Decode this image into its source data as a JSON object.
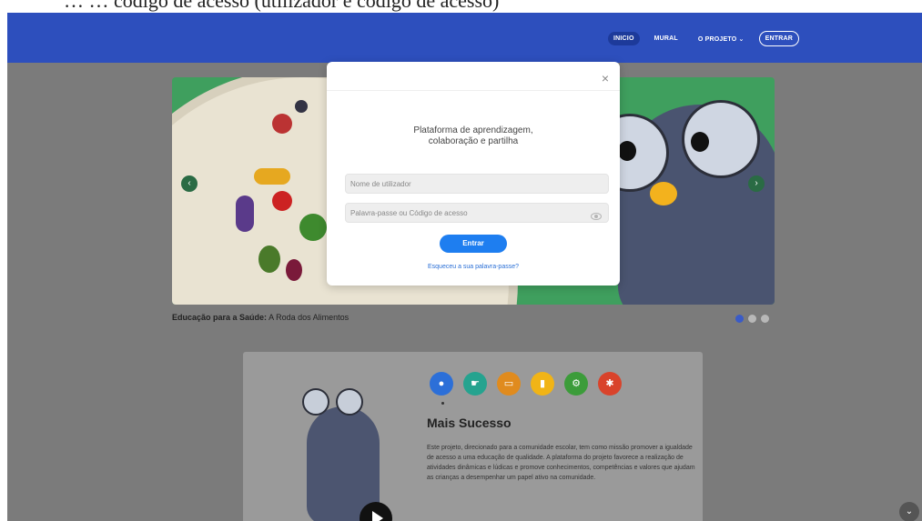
{
  "page_top_text": "… … código de acesso (utilizador e código de acesso)",
  "nav": {
    "items": [
      {
        "label": "INICIO"
      },
      {
        "label": "MURAL"
      },
      {
        "label": "O PROJETO",
        "chevron": "chevron-down-icon"
      },
      {
        "label": "ENTRAR"
      }
    ]
  },
  "carousel": {
    "caption_bold": "Educação para a Saúde:",
    "caption_rest": "A Roda dos Alimentos",
    "prev_icon": "chevron-left-icon",
    "next_icon": "chevron-right-icon",
    "active_slide": 1,
    "slides_count": 3
  },
  "feature_card": {
    "title": "Mais Sucesso",
    "description": "Este projeto, direcionado para a comunidade escolar, tem como missão promover a igualdade de acesso a uma educação de qualidade. A plataforma do projeto favorece a realização de atividades dinâmicas e lúdicas e promove conhecimentos, competências e valores que ajudam as crianças a desempenhar um papel ativo na comunidade.",
    "icons": [
      {
        "name": "chat-icon",
        "color": "#2c6fd8"
      },
      {
        "name": "hand-icon",
        "color": "#25a38f"
      },
      {
        "name": "screen-icon",
        "color": "#e08b1e"
      },
      {
        "name": "book-icon",
        "color": "#f1b416"
      },
      {
        "name": "gears-icon",
        "color": "#3c9c3a"
      },
      {
        "name": "bug-icon",
        "color": "#d9432b"
      }
    ]
  },
  "login_modal": {
    "tagline_line1": "Plataforma de aprendizagem,",
    "tagline_line2": "colaboração e partilha",
    "username_placeholder": "Nome de utilizador",
    "password_placeholder": "Palavra-passe ou Código de acesso",
    "submit_label": "Entrar",
    "forgot_label": "Esqueceu a sua palavra-passe?",
    "close_symbol": "×"
  },
  "colors": {
    "navbar": "#2d4fbd",
    "primary_button": "#1e7ef0",
    "carousel_bg": "#3f9f5e"
  }
}
